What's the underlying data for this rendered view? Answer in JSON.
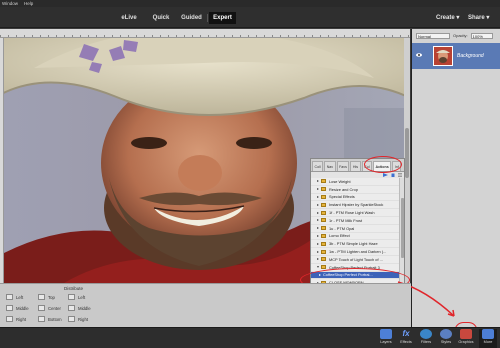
{
  "menubar": {
    "items": [
      "Window",
      "Help"
    ]
  },
  "modes": {
    "elive": "eLive",
    "quick": "Quick",
    "guided": "Guided",
    "expert": "Expert"
  },
  "topbar": {
    "create": "Create ▾",
    "share": "Share ▾"
  },
  "layers": {
    "blend_mode": "Normal",
    "opacity_label": "Opacity:",
    "opacity_value": "100%",
    "layer_name": "Background"
  },
  "actions_panel": {
    "tabs": [
      "Coll",
      "Nav",
      "Favs",
      "His",
      "Col",
      "Actions",
      "Inf"
    ],
    "active_tab": "Actions",
    "items": [
      {
        "label": "Lose Weight",
        "type": "folder"
      },
      {
        "label": "Resize and Crop",
        "type": "folder"
      },
      {
        "label": "Special Effects",
        "type": "folder"
      },
      {
        "label": "Instant Hipster by SparkleStock",
        "type": "folder"
      },
      {
        "label": "1f - PTM Rose Light Wash",
        "type": "folder"
      },
      {
        "label": "1r - PTM Milk Frost",
        "type": "folder"
      },
      {
        "label": "1u - PTM Opal",
        "type": "folder"
      },
      {
        "label": "Lomo Effect",
        "type": "folder"
      },
      {
        "label": "3b - PTM Simple Light Haze",
        "type": "folder"
      },
      {
        "label": "1w - PTM Lighten and Darken (...",
        "type": "folder"
      },
      {
        "label": "MCP Touch of Light Touch of ...",
        "type": "folder"
      },
      {
        "label": "CoffeeShop Perfect Portrait 3",
        "type": "folder"
      },
      {
        "label": "CoffeeShop Perfect Portrai...",
        "type": "action",
        "selected": true
      },
      {
        "label": "CLOSE NEWBORN",
        "type": "folder"
      }
    ]
  },
  "options": {
    "distribute": "Distribute",
    "align": {
      "left": "Left",
      "middle": "Middle",
      "right": "Right"
    },
    "dist": {
      "top": "Top",
      "center": "Center",
      "bottom": "Bottom",
      "left": "Left",
      "middle": "Middle",
      "right": "Right"
    }
  },
  "taskbar": {
    "layers": "Layers",
    "effects": "Effects",
    "filters": "Filters",
    "styles": "Styles",
    "graphics": "Graphics",
    "more": "More"
  }
}
